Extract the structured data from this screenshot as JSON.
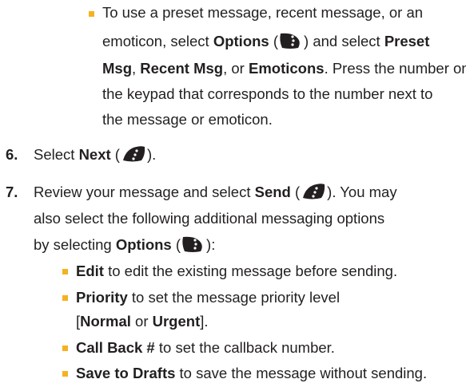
{
  "bullet_preset": {
    "l1": "To use a preset message, recent message, or an",
    "l2_a": "emoticon, select ",
    "l2_options": "Options",
    "l2_open": " (",
    "l2_close": ") and select ",
    "l2_preset": "Preset",
    "l3_msg": "Msg",
    "l3_comma1": ", ",
    "l3_recent": "Recent Msg",
    "l3_or": ", or ",
    "l3_emoticons": "Emoticons",
    "l3_tail": ". Press the number on",
    "l4": "the keypad that corresponds to the number next to",
    "l5": "the message or emoticon."
  },
  "step6": {
    "number": "6.",
    "text_a": "Select ",
    "next": "Next",
    "open": " (",
    "close": ")."
  },
  "step7": {
    "number": "7.",
    "l1_a": "Review your message and select ",
    "send": "Send",
    "l1_open": " (",
    "l1_close": "). You may",
    "l2": "also select the following additional messaging options",
    "l3_a": "by selecting ",
    "options": "Options",
    "l3_open": " (",
    "l3_close": "):"
  },
  "options_list": [
    {
      "term": "Edit",
      "text": " to edit the existing message before sending."
    },
    {
      "term": "Priority",
      "text": " to set the message priority level"
    },
    {
      "term": "Call Back #",
      "text": " to set the callback number."
    },
    {
      "term": "Save to Drafts",
      "text": " to save the message without sending."
    }
  ],
  "priority_cont": {
    "open": "[",
    "normal": "Normal",
    "or": " or ",
    "urgent": "Urgent",
    "close": "]."
  },
  "icons": {
    "right_softkey": "right-softkey-icon",
    "left_softkey": "left-softkey-icon"
  },
  "colors": {
    "text": "#231f20",
    "bullet": "#f4b222",
    "key": "#231f20"
  }
}
